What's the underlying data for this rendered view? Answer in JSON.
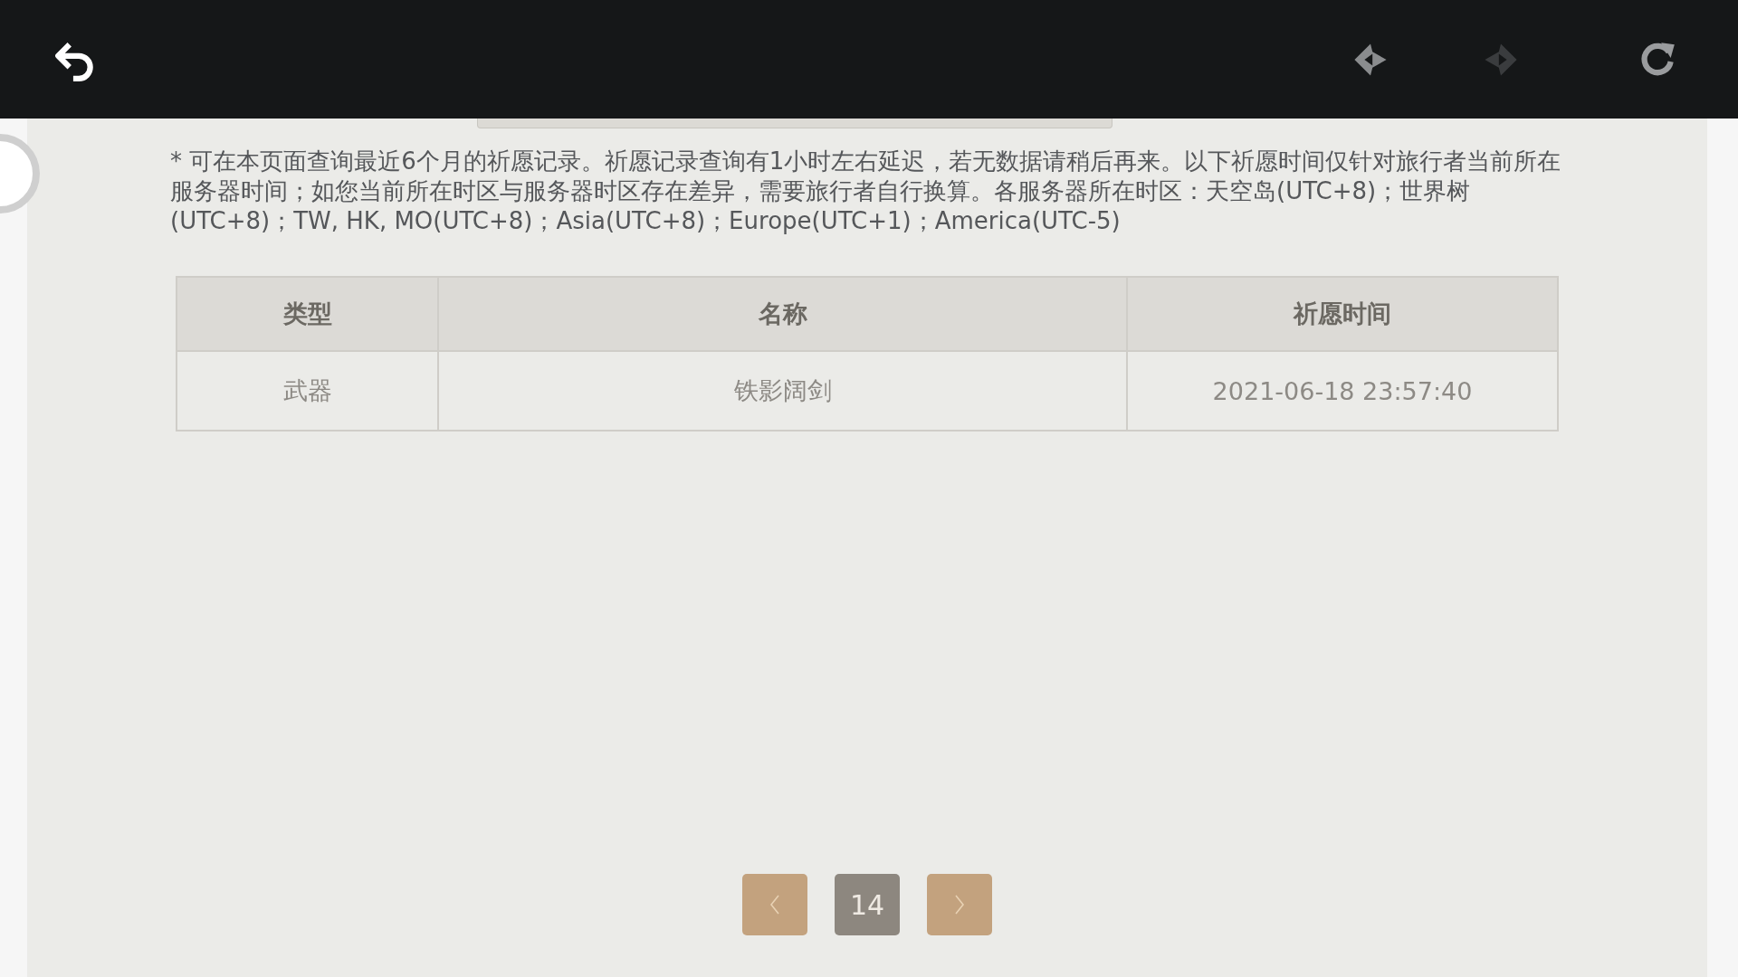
{
  "top_bar": {
    "nav_buttons": [
      {
        "kind": "back",
        "disabled": false
      },
      {
        "kind": "forward",
        "disabled": true
      }
    ]
  },
  "notice": "* 可在本页面查询最近6个月的祈愿记录。祈愿记录查询有1小时左右延迟，若无数据请稍后再来。以下祈愿时间仅针对旅行者当前所在服务器时间；如您当前所在时区与服务器时区存在差异，需要旅行者自行换算。各服务器所在时区：天空岛(UTC+8)；世界树(UTC+8)；TW, HK, MO(UTC+8)；Asia(UTC+8)；Europe(UTC+1)；America(UTC-5)",
  "table": {
    "columns": [
      "类型",
      "名称",
      "祈愿时间"
    ],
    "rows": [
      [
        "武器",
        "铁影阔剑",
        "2021-06-18 23:57:40"
      ]
    ]
  },
  "pagination": {
    "page": "14"
  }
}
